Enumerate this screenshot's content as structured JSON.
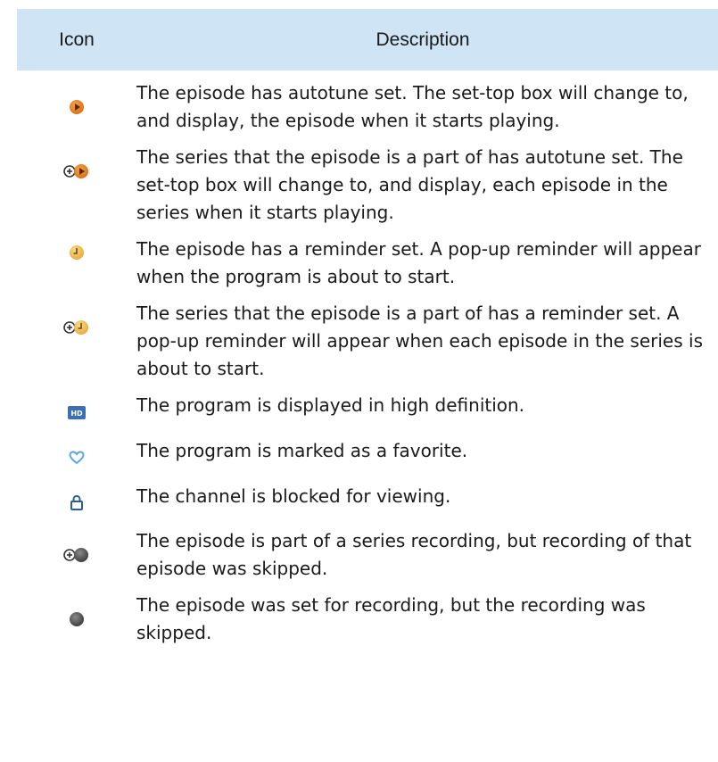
{
  "table": {
    "headers": {
      "icon": "Icon",
      "description": "Description"
    },
    "rows": [
      {
        "icon": "autotune-icon",
        "description": "The episode has autotune set. The set-top box will change to, and display, the episode when it starts playing."
      },
      {
        "icon": "series-autotune-icon",
        "description": "The series that the episode is a part of has autotune set. The set-top box will change to, and display, each episode in the series when it starts playing."
      },
      {
        "icon": "reminder-icon",
        "description": "The episode has a reminder set. A pop-up reminder will appear when the program is about to start."
      },
      {
        "icon": "series-reminder-icon",
        "description": "The series that the episode is a part of has a reminder set. A pop-up reminder will appear when each episode in the series is about to start."
      },
      {
        "icon": "hd-icon",
        "icon_text": "HD",
        "description": "The program is displayed in high definition."
      },
      {
        "icon": "favorite-heart-icon",
        "description": "The program is marked as a favorite."
      },
      {
        "icon": "lock-icon",
        "description": "The channel is blocked for viewing."
      },
      {
        "icon": "series-recording-skipped-icon",
        "description": "The episode is part of a series recording, but recording of that episode was skipped."
      },
      {
        "icon": "recording-skipped-icon",
        "description": "The episode was set for recording, but the recording was skipped."
      }
    ]
  },
  "colors": {
    "header_bg": "#cfe4f5",
    "autotune_orange": "#e8842a",
    "reminder_yellow": "#f2c155",
    "hd_blue": "#3b6fb3",
    "heart_blue": "#5aa8e0",
    "skipped_gray": "#5a5a5a"
  }
}
